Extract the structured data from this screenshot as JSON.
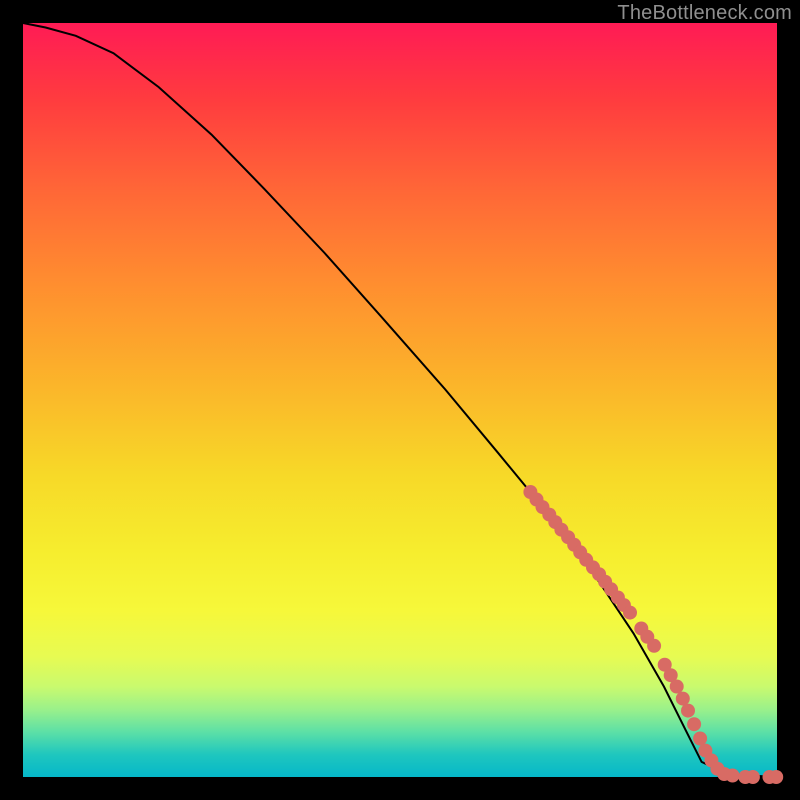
{
  "watermark": "TheBottleneck.com",
  "chart_data": {
    "type": "line",
    "title": "",
    "xlabel": "",
    "ylabel": "",
    "xlim": [
      0,
      100
    ],
    "ylim": [
      0,
      100
    ],
    "grid": false,
    "series": [
      {
        "name": "curve",
        "x": [
          0,
          3,
          7,
          12,
          18,
          25,
          32,
          40,
          48,
          56,
          63,
          70,
          76,
          81,
          85,
          88,
          90,
          93,
          96,
          100
        ],
        "y": [
          100,
          99.4,
          98.3,
          96.0,
          91.5,
          85.2,
          78.0,
          69.5,
          60.5,
          51.4,
          43.0,
          34.5,
          26.5,
          19.0,
          12.0,
          6.0,
          2.0,
          0.6,
          0.2,
          0.0
        ]
      }
    ],
    "highlight_points": {
      "name": "hot-segment",
      "color": "#d86b64",
      "x": [
        67.3,
        68.1,
        68.9,
        69.8,
        70.6,
        71.4,
        72.3,
        73.1,
        73.9,
        74.7,
        75.6,
        76.4,
        77.2,
        78.0,
        78.9,
        79.7,
        80.5,
        82.0,
        82.8,
        83.7,
        85.1,
        85.9,
        86.7,
        87.5,
        88.2,
        89.0,
        89.8,
        90.5,
        91.3,
        92.1,
        93.0,
        94.1,
        95.8,
        96.8,
        99.0,
        99.9
      ],
      "y": [
        37.8,
        36.8,
        35.8,
        34.8,
        33.8,
        32.8,
        31.8,
        30.8,
        29.8,
        28.8,
        27.8,
        26.9,
        25.9,
        24.9,
        23.8,
        22.8,
        21.8,
        19.7,
        18.6,
        17.4,
        14.9,
        13.5,
        12.0,
        10.4,
        8.8,
        7.0,
        5.1,
        3.5,
        2.2,
        1.1,
        0.4,
        0.2,
        0.0,
        0.0,
        0.0,
        0.0
      ]
    }
  },
  "colors": {
    "background": "#000000",
    "curve": "#000000",
    "dots": "#d86b64",
    "watermark": "#8f8f8f"
  }
}
